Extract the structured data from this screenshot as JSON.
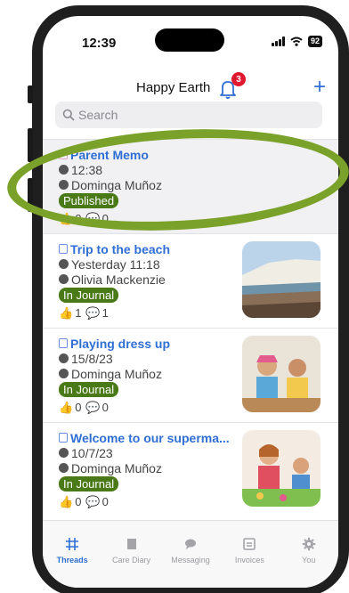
{
  "status": {
    "time": "12:39",
    "battery": "92"
  },
  "header": {
    "title": "Happy Earth",
    "notification_count": "3",
    "add_label": "+"
  },
  "search": {
    "placeholder": "Search"
  },
  "threads": [
    {
      "title": "Parent Memo",
      "time": "12:38",
      "author": "Dominga Muñoz",
      "tag": "Published",
      "likes": "0",
      "comments": "0",
      "has_thumb": false
    },
    {
      "title": "Trip to the beach",
      "time": "Yesterday 11:18",
      "author": "Olivia Mackenzie",
      "tag": "In Journal",
      "likes": "1",
      "comments": "1",
      "has_thumb": true,
      "thumb": "beach-photo"
    },
    {
      "title": "Playing dress up",
      "time": "15/8/23",
      "author": "Dominga Muñoz",
      "tag": "In Journal",
      "likes": "0",
      "comments": "0",
      "has_thumb": true,
      "thumb": "kids-dress-up-photo"
    },
    {
      "title": "Welcome to our superma...",
      "time": "10/7/23",
      "author": "Dominga Muñoz",
      "tag": "In Journal",
      "likes": "0",
      "comments": "0",
      "has_thumb": true,
      "thumb": "kids-play-photo"
    }
  ],
  "tabs": [
    {
      "label": "Threads",
      "icon": "hash-grid-icon",
      "active": true
    },
    {
      "label": "Care Diary",
      "icon": "book-icon",
      "active": false
    },
    {
      "label": "Messaging",
      "icon": "chat-bubble-icon",
      "active": false
    },
    {
      "label": "Invoices",
      "icon": "invoice-icon",
      "active": false
    },
    {
      "label": "You",
      "icon": "gear-icon",
      "active": false
    }
  ],
  "colors": {
    "accent": "#2f6fd4",
    "tag_green": "#4a7a18",
    "badge_red": "#e0192f",
    "annotation_green": "#7aa22a"
  }
}
